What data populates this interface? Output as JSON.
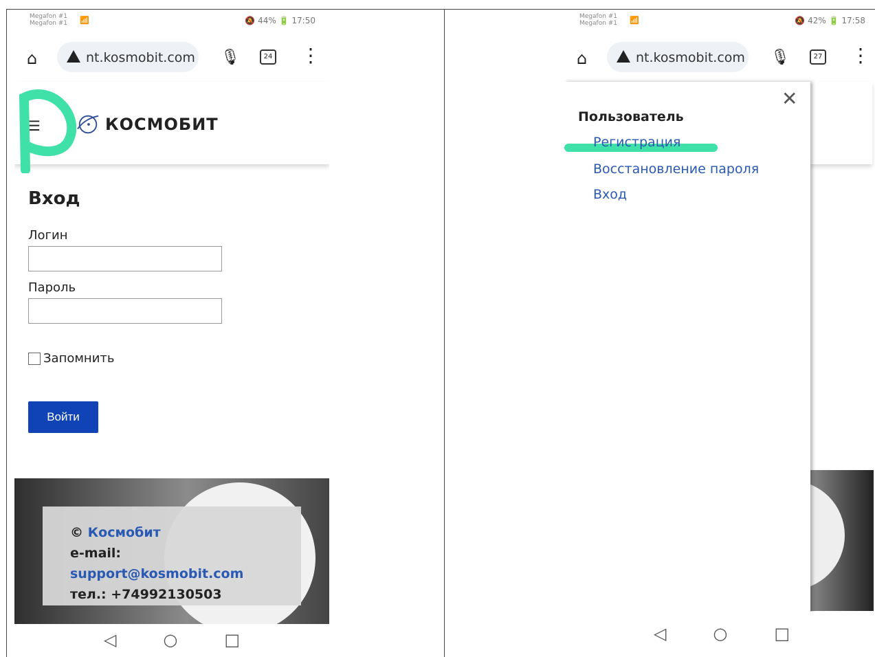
{
  "left_phone": {
    "status": {
      "operator1": "Megafon #1",
      "operator2": "Megafon #1",
      "signal": "📶",
      "right": "🔕 44% 🔋 17:50"
    },
    "browser": {
      "url": "nt.kosmobit.com",
      "tabs_count": "24"
    },
    "site": {
      "brand": "КОСМОБИТ",
      "login_title": "Вход",
      "login_label": "Логин",
      "password_label": "Пароль",
      "remember_label": "Запомнить",
      "submit_label": "Войти"
    },
    "footer": {
      "copyright": "© ",
      "company": "Космобит",
      "email_label": "e-mail:",
      "email": "support@kosmobit.com",
      "phone": "тел.: +74992130503"
    }
  },
  "right_phone": {
    "status": {
      "operator1": "Megafon #1",
      "operator2": "Megafon #1",
      "signal": "📶",
      "right": "🔕 42% 🔋 17:58"
    },
    "browser": {
      "url": "nt.kosmobit.com",
      "tabs_count": "27"
    },
    "drawer": {
      "title": "Пользователь",
      "links": [
        "Регистрация",
        "Восстановление пароля",
        "Вход"
      ]
    }
  },
  "annotation": {
    "color": "#3fe1a8"
  }
}
